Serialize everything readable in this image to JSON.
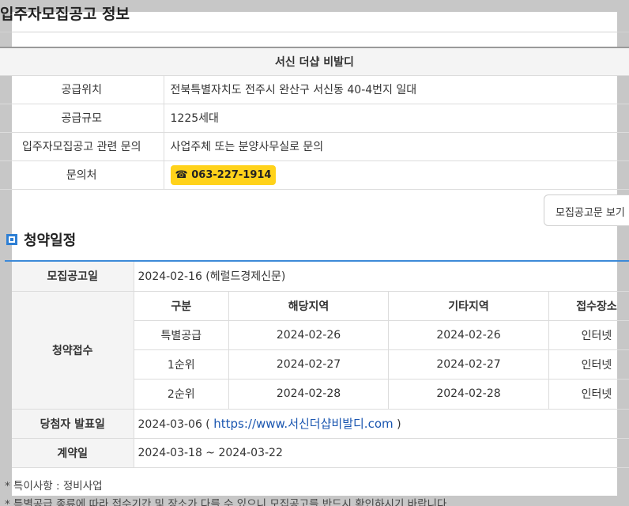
{
  "page_title": "입주자모집공고 정보",
  "info": {
    "header": "서신 더샵 비발디",
    "rows": [
      {
        "label": "공급위치",
        "value": "전북특별자치도 전주시 완산구 서신동 40-4번지 일대"
      },
      {
        "label": "공급규모",
        "value": "1225세대"
      },
      {
        "label": "입주자모집공고 관련 문의",
        "value": "사업주체 또는 분양사무실로 문의"
      }
    ],
    "contact_label": "문의처",
    "contact_icon": "☎",
    "contact_phone": "063-227-1914"
  },
  "view_button": "모집공고문 보기",
  "schedule": {
    "title": "청약일정",
    "announce_label": "모집공고일",
    "announce_value": "2024-02-16 (헤럴드경제신문)",
    "apply_label": "청약접수",
    "apply_headers": [
      "구분",
      "해당지역",
      "기타지역",
      "접수장소"
    ],
    "apply_rows": [
      [
        "특별공급",
        "2024-02-26",
        "2024-02-26",
        "인터넷"
      ],
      [
        "1순위",
        "2024-02-27",
        "2024-02-27",
        "인터넷"
      ],
      [
        "2순위",
        "2024-02-28",
        "2024-02-28",
        "인터넷"
      ]
    ],
    "winner_label": "당첨자 발표일",
    "winner_date": "2024-03-06 (",
    "winner_link": "https://www.서신더샵비발디.com",
    "winner_close": ")",
    "contract_label": "계약일",
    "contract_value": "2024-03-18 ~ 2024-03-22"
  },
  "notes": [
    "* 특이사항 : 정비사업",
    "* 특별공급 종류에 따라 접수기간 및 장소가 다를 수 있으니 모집공고를 반드시 확인하시기 바랍니다."
  ],
  "colors": {
    "accent": "#2e7fd4",
    "badge": "#ffd21a",
    "link": "#1a56b0"
  }
}
